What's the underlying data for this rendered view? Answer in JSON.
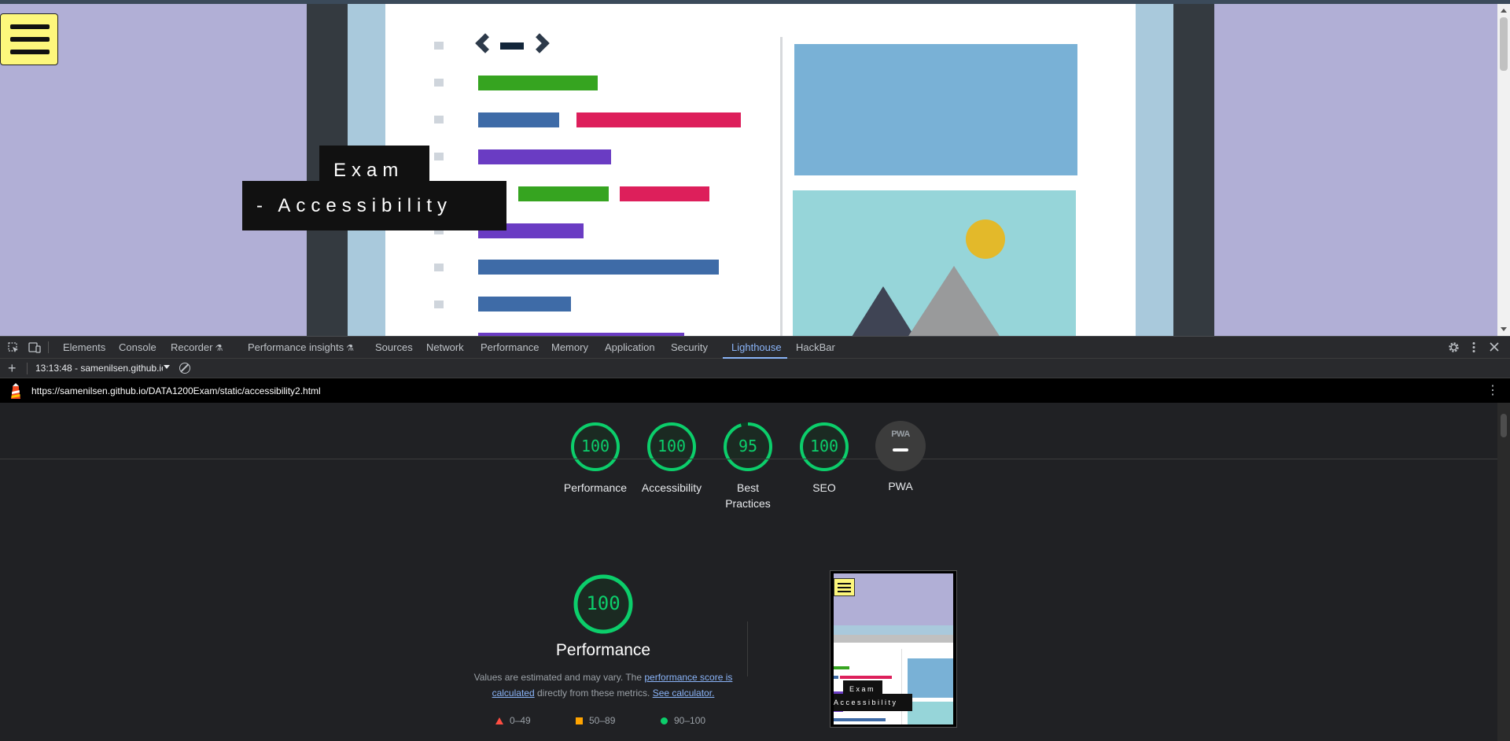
{
  "page": {
    "exam_text": "Exam",
    "accessibility_text": "- Accessibility"
  },
  "devtools": {
    "tabs": [
      {
        "label": "Elements"
      },
      {
        "label": "Console"
      },
      {
        "label": "Recorder"
      },
      {
        "label": "Performance insights"
      },
      {
        "label": "Sources"
      },
      {
        "label": "Network"
      },
      {
        "label": "Performance"
      },
      {
        "label": "Memory"
      },
      {
        "label": "Application"
      },
      {
        "label": "Security"
      },
      {
        "label": "Lighthouse"
      },
      {
        "label": "HackBar"
      }
    ],
    "active_tab": "Lighthouse",
    "icons": [
      "inspect-icon",
      "device-toolbar-icon",
      "settings-icon",
      "more-vert-icon",
      "close-icon"
    ]
  },
  "lighthouse": {
    "report_select": "13:13:48 - samenilsen.github.io",
    "url": "https://samenilsen.github.io/DATA1200Exam/static/accessibility2.html",
    "scores": [
      {
        "label": "Performance",
        "score": "100",
        "value": 100
      },
      {
        "label": "Accessibility",
        "score": "100",
        "value": 100
      },
      {
        "label": "Best Practices",
        "score": "95",
        "value": 95
      },
      {
        "label": "SEO",
        "score": "100",
        "value": 100
      },
      {
        "label": "PWA",
        "score": "",
        "value": null
      }
    ],
    "pwa_badge": "PWA",
    "performance": {
      "score": "100",
      "title": "Performance",
      "desc_prefix": "Values are estimated and may vary. The ",
      "desc_link": "performance score is calculated",
      "desc_mid": " directly from these metrics. ",
      "desc_link2": "See calculator.",
      "legend": [
        {
          "range": "0–49",
          "shape": "triangle",
          "color": "#ff4e42"
        },
        {
          "range": "50–89",
          "shape": "square",
          "color": "#ffa400"
        },
        {
          "range": "90–100",
          "shape": "circle",
          "color": "#0cce6b"
        }
      ]
    },
    "thumbnail": {
      "exam_text": "Exam",
      "accessibility_text": "Accessibility"
    }
  },
  "colors": {
    "page_bg": "#b1afd6",
    "menu_button": "#fdf77c",
    "pass_green": "#0cce6b",
    "devtools_bg": "#202124",
    "link": "#8ab4f8"
  }
}
